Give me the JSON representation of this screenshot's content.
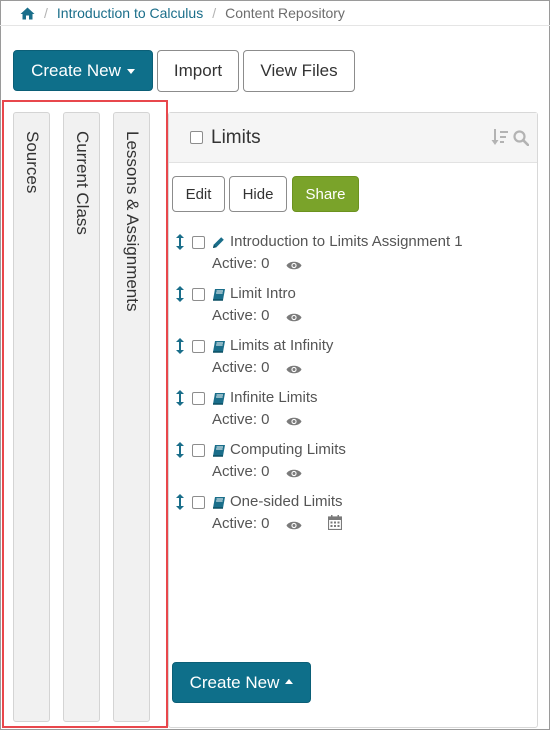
{
  "breadcrumb": {
    "home_icon": "home-icon",
    "separator": "/",
    "course": "Introduction to Calculus",
    "current": "Content Repository"
  },
  "toolbar": {
    "create_new_label": "Create New",
    "import_label": "Import",
    "view_files_label": "View Files"
  },
  "side_tabs": [
    {
      "label": "Sources"
    },
    {
      "label": "Current Class"
    },
    {
      "label": "Lessons & Assignments"
    }
  ],
  "panel": {
    "title": "Limits",
    "actions": {
      "edit": "Edit",
      "hide": "Hide",
      "share": "Share"
    },
    "items": [
      {
        "title": "Introduction to Limits Assignment 1",
        "icon": "pencil-icon",
        "active": "Active: 0",
        "has_calendar": false
      },
      {
        "title": "Limit Intro",
        "icon": "book-icon",
        "active": "Active: 0",
        "has_calendar": false
      },
      {
        "title": "Limits at Infinity",
        "icon": "book-icon",
        "active": "Active: 0",
        "has_calendar": false
      },
      {
        "title": "Infinite Limits",
        "icon": "book-icon",
        "active": "Active: 0",
        "has_calendar": false
      },
      {
        "title": "Computing Limits",
        "icon": "book-icon",
        "active": "Active: 0",
        "has_calendar": false
      },
      {
        "title": "One-sided Limits",
        "icon": "book-icon",
        "active": "Active: 0",
        "has_calendar": true
      }
    ],
    "create_new_label": "Create New"
  },
  "colors": {
    "primary": "#0e6f8a",
    "success": "#7aa32a",
    "highlight": "#e8474c",
    "link": "#1a6e8a"
  }
}
